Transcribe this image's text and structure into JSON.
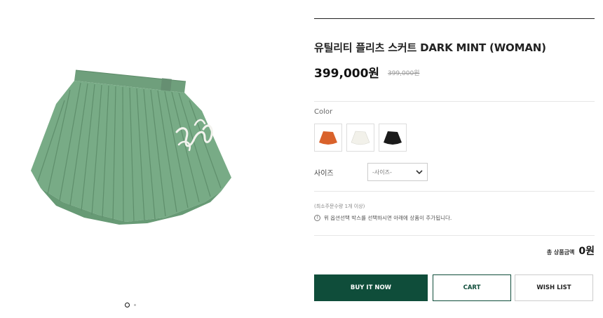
{
  "product": {
    "title": "유틸리티 플리츠 스커트 DARK MINT (WOMAN)",
    "price": "399,000원",
    "original_price": "399,000원"
  },
  "options": {
    "color_label": "Color",
    "colors": [
      {
        "name": "orange",
        "hex": "#d9622b"
      },
      {
        "name": "white",
        "hex": "#f2f1ea"
      },
      {
        "name": "black",
        "hex": "#1b1b1b"
      }
    ],
    "size_label": "사이즈",
    "size_placeholder": "-사이즈-"
  },
  "notes": {
    "min_order": "(최소주문수량 1개 이상)",
    "notice": "위 옵션선택 박스를 선택하시면 아래에 상품이 추가됩니다.",
    "notice_icon": "!"
  },
  "total": {
    "label": "총 상품금액",
    "value": "0원"
  },
  "buttons": {
    "buy": "BUY IT NOW",
    "cart": "CART",
    "wish": "WISH LIST"
  },
  "gallery": {
    "image": "mint-pleated-skirt",
    "skirt_color": "#75a883",
    "current_slide": 1,
    "total_slides": 2
  }
}
